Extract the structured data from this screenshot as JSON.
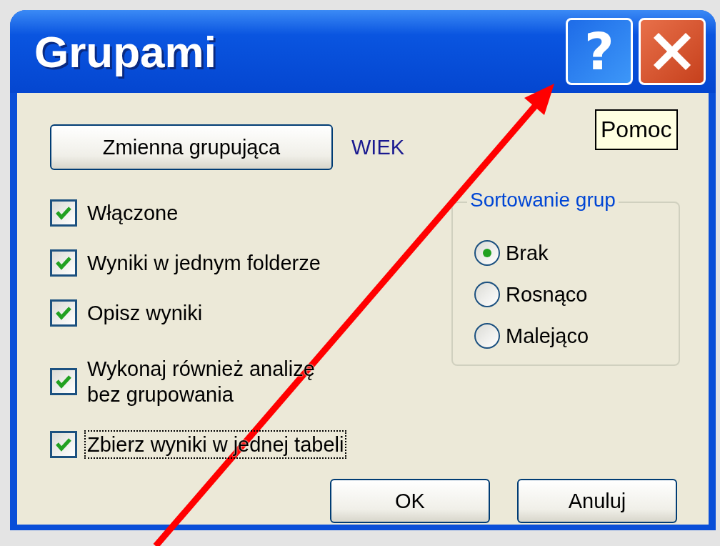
{
  "window": {
    "title": "Grupami",
    "title_buttons": [
      {
        "kind": "help",
        "label": "?"
      },
      {
        "kind": "close"
      }
    ]
  },
  "tooltip": {
    "text": "Pomoc"
  },
  "grouping": {
    "button": "Zmienna grupująca",
    "value": "WIEK"
  },
  "options": [
    {
      "label": "Włączone",
      "checked": true,
      "focused": false
    },
    {
      "label": "Wyniki w jednym folderze",
      "checked": true,
      "focused": false
    },
    {
      "label": "Opisz wyniki",
      "checked": true,
      "focused": false
    },
    {
      "label": "Wykonaj również analizę bez grupowania",
      "checked": true,
      "focused": false
    },
    {
      "label": "Zbierz wyniki w jednej tabeli",
      "checked": true,
      "focused": true
    }
  ],
  "sort_group": {
    "title": "Sortowanie grup",
    "options": [
      {
        "label": "Brak",
        "selected": true
      },
      {
        "label": "Rosnąco",
        "selected": false
      },
      {
        "label": "Malejąco",
        "selected": false
      }
    ]
  },
  "buttons": [
    "OK",
    "Anuluj"
  ]
}
